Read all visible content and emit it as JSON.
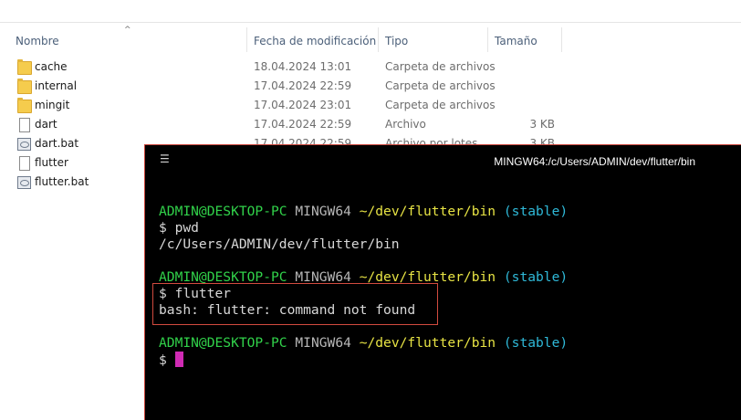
{
  "explorer": {
    "columns": {
      "name": "Nombre",
      "date": "Fecha de modificación",
      "type": "Tipo",
      "size": "Tamaño"
    },
    "files": [
      {
        "name": "cache",
        "date": "18.04.2024 13:01",
        "type": "Carpeta de archivos",
        "size": "",
        "icon": "folder-icon"
      },
      {
        "name": "internal",
        "date": "17.04.2024 22:59",
        "type": "Carpeta de archivos",
        "size": "",
        "icon": "folder-icon"
      },
      {
        "name": "mingit",
        "date": "17.04.2024 23:01",
        "type": "Carpeta de archivos",
        "size": "",
        "icon": "folder-icon"
      },
      {
        "name": "dart",
        "date": "17.04.2024 22:59",
        "type": "Archivo",
        "size": "3 KB",
        "icon": "file-icon"
      },
      {
        "name": "dart.bat",
        "date": "17.04.2024 22:59",
        "type": "Archivo por lotes",
        "size": "3 KB",
        "icon": "batch-file-icon"
      },
      {
        "name": "flutter",
        "date": "",
        "type": "",
        "size": "",
        "icon": "file-icon"
      },
      {
        "name": "flutter.bat",
        "date": "",
        "type": "",
        "size": "",
        "icon": "batch-file-icon"
      }
    ]
  },
  "terminal": {
    "menu_icon": "hamburger-menu-icon",
    "title": "MINGW64:/c/Users/ADMIN/dev/flutter/bin",
    "prompt_user": "ADMIN@DESKTOP-PC",
    "prompt_env": "MINGW64",
    "prompt_path": "~/dev/flutter/bin",
    "prompt_branch": "(stable)",
    "cmd1": "$ pwd",
    "out1": "/c/Users/ADMIN/dev/flutter/bin",
    "cmd2": "$ flutter",
    "out2": "bash: flutter: command not found",
    "cmd3": "$ ",
    "colors": {
      "user": "#31d24a",
      "path": "#e8e444",
      "branch": "#2fb9d8",
      "cursor": "#d02bb4",
      "highlight_border": "#d24b3f"
    }
  }
}
